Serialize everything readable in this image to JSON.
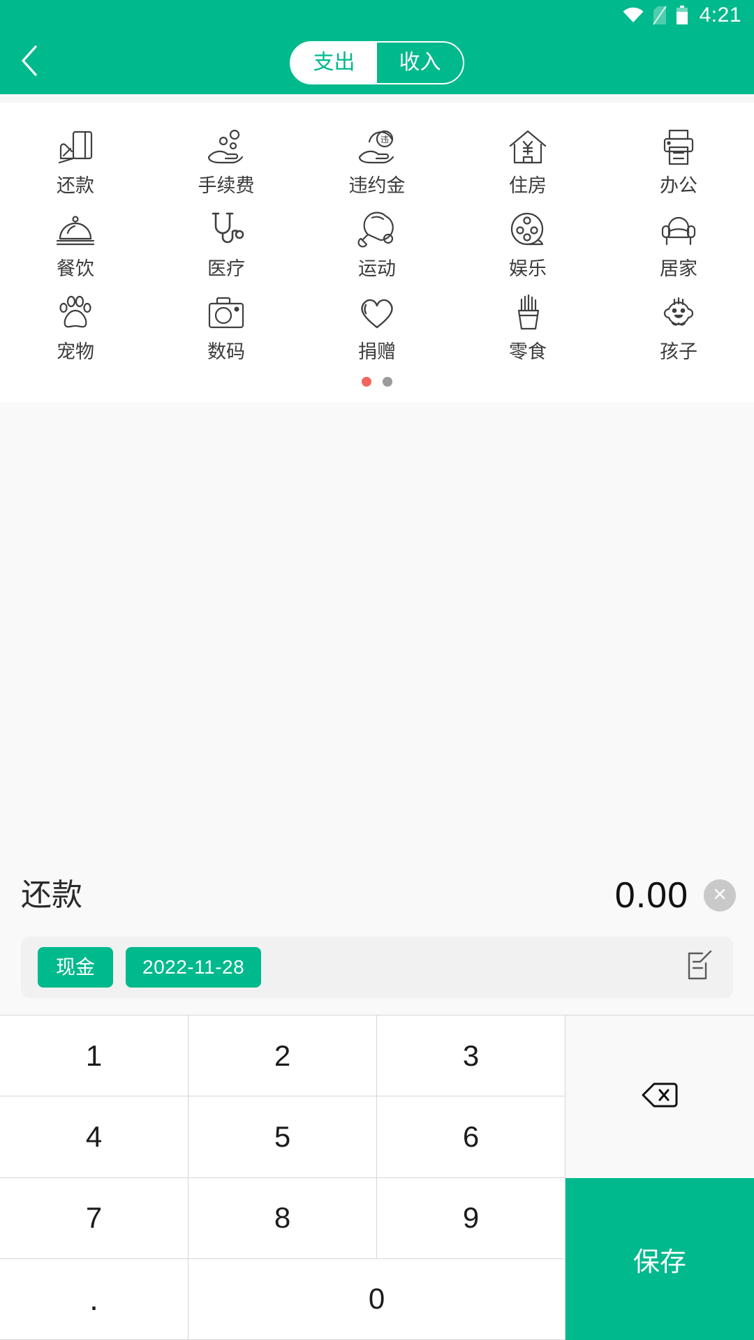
{
  "statusbar": {
    "time": "4:21",
    "icons": [
      "wifi-icon",
      "sim-card-off-icon",
      "battery-icon"
    ]
  },
  "appbar": {
    "back_icon": "chevron-left-icon",
    "tabs": [
      {
        "label": "支出",
        "active": true
      },
      {
        "label": "收入",
        "active": false
      }
    ]
  },
  "categories": {
    "rows": [
      [
        {
          "label": "还款",
          "icon": "hand-card-icon"
        },
        {
          "label": "手续费",
          "icon": "hand-coins-icon"
        },
        {
          "label": "违约金",
          "icon": "hand-penalty-icon"
        },
        {
          "label": "住房",
          "icon": "house-yen-icon"
        },
        {
          "label": "办公",
          "icon": "printer-icon"
        }
      ],
      [
        {
          "label": "餐饮",
          "icon": "food-cloche-icon"
        },
        {
          "label": "医疗",
          "icon": "stethoscope-icon"
        },
        {
          "label": "运动",
          "icon": "pingpong-paddle-icon"
        },
        {
          "label": "娱乐",
          "icon": "film-reel-icon"
        },
        {
          "label": "居家",
          "icon": "armchair-icon"
        }
      ],
      [
        {
          "label": "宠物",
          "icon": "paw-print-icon"
        },
        {
          "label": "数码",
          "icon": "camera-icon"
        },
        {
          "label": "捐赠",
          "icon": "heart-icon"
        },
        {
          "label": "零食",
          "icon": "fries-icon"
        },
        {
          "label": "孩子",
          "icon": "baby-face-icon"
        }
      ]
    ],
    "pager": {
      "total": 2,
      "active_index": 0,
      "active_color": "#f4645f",
      "inactive_color": "#9b9b9b"
    }
  },
  "entry": {
    "selected_category": "还款",
    "amount": "0.00",
    "clear_icon": "close-circle-icon",
    "account_chip": "现金",
    "date_chip": "2022-11-28",
    "note_icon": "note-edit-icon"
  },
  "keypad": {
    "keys": [
      "1",
      "2",
      "3",
      "4",
      "5",
      "6",
      "7",
      "8",
      "9",
      ".",
      "0"
    ],
    "delete_icon": "backspace-icon",
    "save_label": "保存"
  },
  "colors": {
    "brand_green": "#00b98c",
    "panel_bg": "#f9f9f9",
    "chip_bg": "#00b98c"
  }
}
